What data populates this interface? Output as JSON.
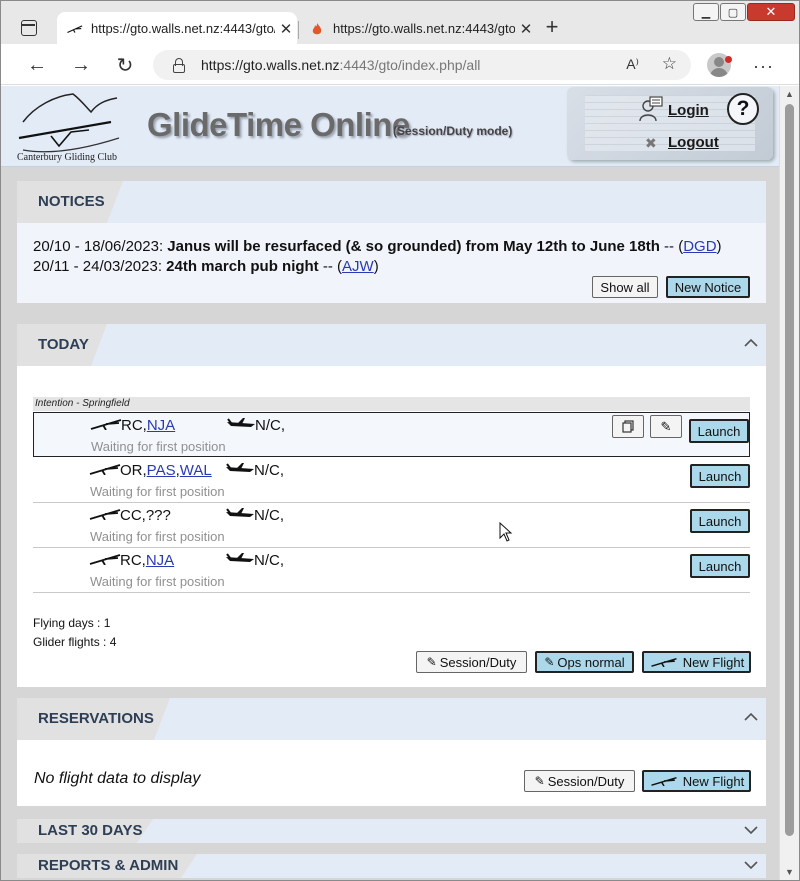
{
  "browser": {
    "tabs": [
      {
        "title": "https://gto.walls.net.nz:4443/gto/",
        "active": true
      },
      {
        "title": "https://gto.walls.net.nz:4443/gto/",
        "active": false
      }
    ],
    "url_host": "https://gto.walls.net.nz",
    "url_path": ":4443/gto/index.php/all",
    "readaloud_icon": "A⁾"
  },
  "header": {
    "logo_text": "Canterbury Gliding Club",
    "app_title": "GlideTime Online",
    "app_mode": "(Session/Duty mode)",
    "login": "Login",
    "logout": "Logout",
    "help": "?"
  },
  "notices": {
    "title": "NOTICES",
    "items": [
      {
        "dates": "20/10 - 18/06/2023: ",
        "text": "Janus will be resurfaced (& so grounded) from May 12th to June 18th",
        "sep": " -- (",
        "author": "DGD",
        "close": ")"
      },
      {
        "dates": "20/11 - 24/03/2023: ",
        "text": "24th march pub night",
        "sep": " -- (",
        "author": "AJW",
        "close": ")"
      }
    ],
    "show_all": "Show all",
    "new_notice": "New Notice"
  },
  "today": {
    "title": "TODAY",
    "intention": "Intention - Springfield",
    "flights": [
      {
        "glider": "RC",
        "sep": ",",
        "crew": [
          {
            "name": "NJA",
            "link": true
          }
        ],
        "tug": "N/C,",
        "status": "Waiting for first position",
        "launch": "Launch",
        "selected": true
      },
      {
        "glider": "OR",
        "sep": ",",
        "crew": [
          {
            "name": "PAS",
            "link": true
          },
          {
            "name": "WAL",
            "link": true
          }
        ],
        "tug": "N/C,",
        "status": "Waiting for first position",
        "launch": "Launch",
        "selected": false
      },
      {
        "glider": "CC",
        "sep": ",",
        "crew": [
          {
            "name": "???",
            "link": false
          }
        ],
        "tug": "N/C,",
        "status": "Waiting for first position",
        "launch": "Launch",
        "selected": false
      },
      {
        "glider": "RC",
        "sep": ",",
        "crew": [
          {
            "name": "NJA",
            "link": true
          }
        ],
        "tug": "N/C,",
        "status": "Waiting for first position",
        "launch": "Launch",
        "selected": false
      }
    ],
    "flying_days": "Flying days : 1",
    "glider_flights": "Glider flights : 4",
    "session_duty": "Session/Duty",
    "ops_normal": "Ops normal",
    "new_flight": "New Flight"
  },
  "reservations": {
    "title": "RESERVATIONS",
    "no_data": "No flight data to display",
    "session_duty": "Session/Duty",
    "new_flight": "New Flight"
  },
  "last30": {
    "title": "LAST 30 DAYS"
  },
  "reports": {
    "title": "REPORTS & ADMIN"
  },
  "colors": {
    "header_bg": "#e3ebf7",
    "button_blue": "#abd8ea",
    "link": "#2a3ab5",
    "title": "#2d3e55"
  }
}
